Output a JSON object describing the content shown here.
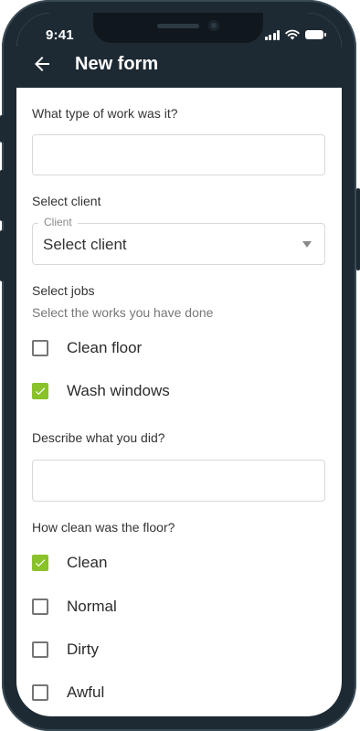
{
  "status_bar": {
    "time": "9:41"
  },
  "header": {
    "title": "New form"
  },
  "form": {
    "q_work_type": {
      "label": "What type of work was it?",
      "value": ""
    },
    "q_client": {
      "label": "Select client",
      "legend": "Client",
      "value": "Select client"
    },
    "q_jobs": {
      "label": "Select jobs",
      "hint": "Select the works you have done",
      "options": [
        {
          "label": "Clean floor",
          "checked": false
        },
        {
          "label": "Wash windows",
          "checked": true
        }
      ]
    },
    "q_describe": {
      "label": "Describe what you did?",
      "value": ""
    },
    "q_floor": {
      "label": "How clean was the floor?",
      "options": [
        {
          "label": "Clean",
          "checked": true
        },
        {
          "label": "Normal",
          "checked": false
        },
        {
          "label": "Dirty",
          "checked": false
        },
        {
          "label": "Awful",
          "checked": false
        }
      ]
    }
  },
  "colors": {
    "appbar": "#1e2a33",
    "accent": "#8ac22a"
  }
}
